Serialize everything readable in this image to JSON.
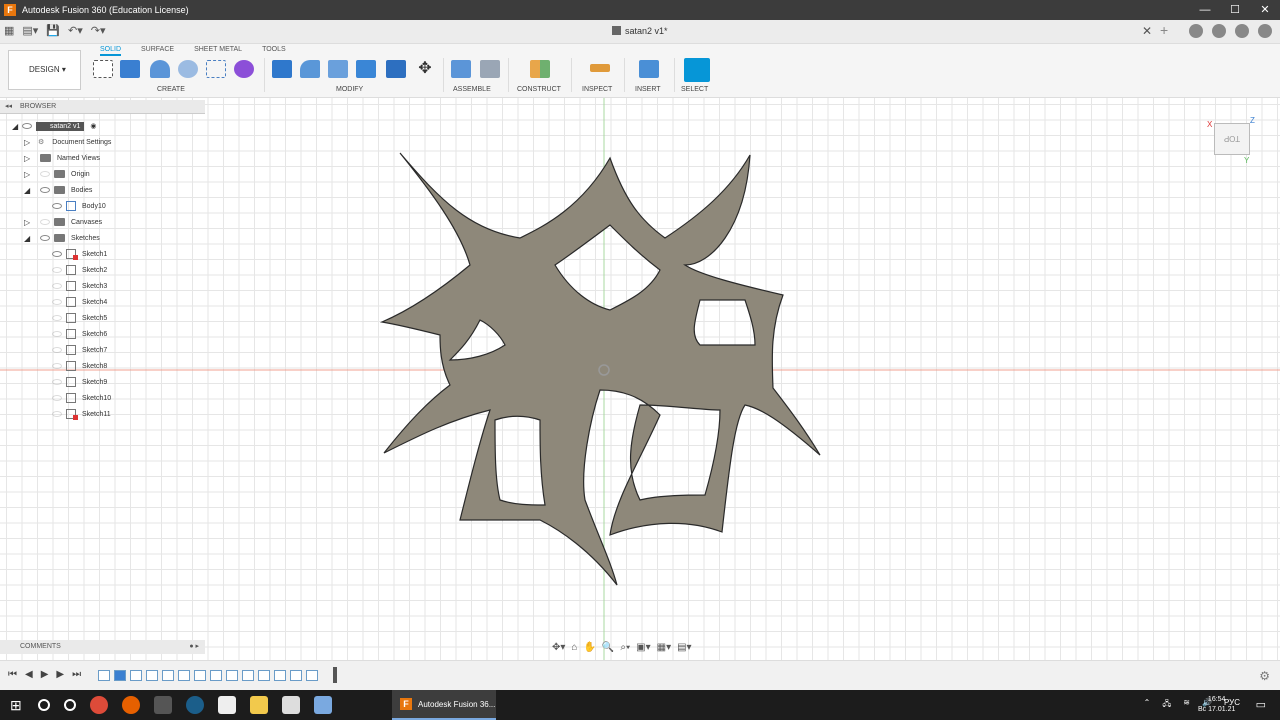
{
  "window": {
    "title": "Autodesk Fusion 360 (Education License)"
  },
  "document_tab": {
    "name": "satan2 v1*"
  },
  "ribbon": {
    "workspace": "DESIGN",
    "tabs": [
      "SOLID",
      "SURFACE",
      "SHEET METAL",
      "TOOLS"
    ],
    "active_tab": "SOLID",
    "groups": [
      "CREATE",
      "MODIFY",
      "ASSEMBLE",
      "CONSTRUCT",
      "INSPECT",
      "INSERT",
      "SELECT"
    ]
  },
  "browser": {
    "header": "BROWSER",
    "root": "satan2 v1",
    "items": [
      {
        "label": "Document Settings"
      },
      {
        "label": "Named Views"
      },
      {
        "label": "Origin"
      },
      {
        "label": "Bodies"
      },
      {
        "label": "Body10"
      },
      {
        "label": "Canvases"
      },
      {
        "label": "Sketches"
      }
    ],
    "sketches": [
      "Sketch1",
      "Sketch2",
      "Sketch3",
      "Sketch4",
      "Sketch5",
      "Sketch6",
      "Sketch7",
      "Sketch8",
      "Sketch9",
      "Sketch10",
      "Sketch11"
    ]
  },
  "comments": {
    "label": "COMMENTS"
  },
  "viewcube": {
    "face": "TOP"
  },
  "taskbar": {
    "active_app": "Autodesk Fusion 36...",
    "lang": "РУС",
    "time": "16:54",
    "date": "Вс 17.01.21"
  }
}
